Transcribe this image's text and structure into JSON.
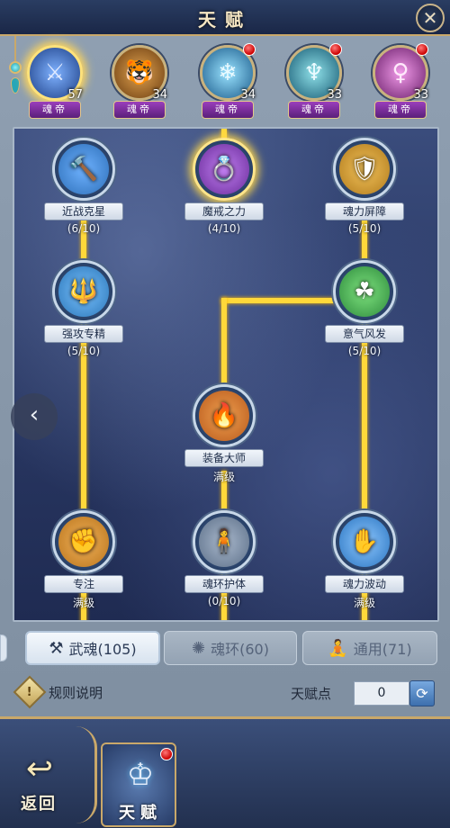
{
  "header": {
    "title": "天赋"
  },
  "spirits": [
    {
      "name": "spirit-1",
      "level": "57",
      "rank": "魂帝",
      "active": true,
      "has_dot": false,
      "color": "#3a76c8",
      "glyph": "⚔"
    },
    {
      "name": "spirit-2",
      "level": "34",
      "rank": "魂帝",
      "active": false,
      "has_dot": false,
      "color": "#b7772d",
      "glyph": "🐯"
    },
    {
      "name": "spirit-3",
      "level": "34",
      "rank": "魂帝",
      "active": false,
      "has_dot": true,
      "color": "#3aa3d8",
      "glyph": "❄"
    },
    {
      "name": "spirit-4",
      "level": "33",
      "rank": "魂帝",
      "active": false,
      "has_dot": true,
      "color": "#2f8fb0",
      "glyph": "♆"
    },
    {
      "name": "spirit-5",
      "level": "33",
      "rank": "魂帝",
      "active": false,
      "has_dot": true,
      "color": "#b84ab0",
      "glyph": "♀"
    }
  ],
  "talents": [
    {
      "key": "melee",
      "name": "近战克星",
      "progress": "(6/10)",
      "gold": false,
      "glyph": "🔨",
      "color": "#2d6fb8"
    },
    {
      "key": "demon",
      "name": "魔戒之力",
      "progress": "(4/10)",
      "gold": true,
      "glyph": "💍",
      "color": "#6a2c9a"
    },
    {
      "key": "barrier",
      "name": "魂力屏障",
      "progress": "(5/10)",
      "gold": false,
      "glyph": "🛡",
      "color": "#b07a1c"
    },
    {
      "key": "attack",
      "name": "强攻专精",
      "progress": "(5/10)",
      "gold": false,
      "glyph": "🔱",
      "color": "#2b76b8"
    },
    {
      "key": "spirit",
      "name": "意气风发",
      "progress": "(5/10)",
      "gold": false,
      "glyph": "☘",
      "color": "#2d8a3c"
    },
    {
      "key": "equip",
      "name": "装备大师",
      "progress": "满级",
      "gold": false,
      "glyph": "🔥",
      "color": "#b85a1c"
    },
    {
      "key": "focus",
      "name": "专注",
      "progress": "满级",
      "gold": false,
      "glyph": "✊",
      "color": "#b8741c"
    },
    {
      "key": "ringguard",
      "name": "魂环护体",
      "progress": "(0/10)",
      "gold": false,
      "glyph": "🧍",
      "color": "#5c6f88"
    },
    {
      "key": "wave",
      "name": "魂力波动",
      "progress": "满级",
      "gold": false,
      "glyph": "✋",
      "color": "#2a74c0"
    }
  ],
  "tabs": [
    {
      "label": "武魂(105)",
      "icon": "hammer-icon",
      "glyph": "⚒",
      "active": true
    },
    {
      "label": "魂环(60)",
      "icon": "ring-icon",
      "glyph": "✺",
      "active": false
    },
    {
      "label": "通用(71)",
      "icon": "meditate-icon",
      "glyph": "🧘",
      "active": false
    }
  ],
  "rules": {
    "label": "规则说明",
    "icon_glyph": "!"
  },
  "points": {
    "label": "天赋点",
    "value": "0"
  },
  "bottom": {
    "back_label": "返回",
    "talent_label": "天赋",
    "back_glyph": "↩",
    "talent_glyph": "♔"
  },
  "colors": {
    "accent_gold": "#ffd83a",
    "frame_gold": "#c9a86a",
    "panel_blue": "#2b3a66"
  }
}
